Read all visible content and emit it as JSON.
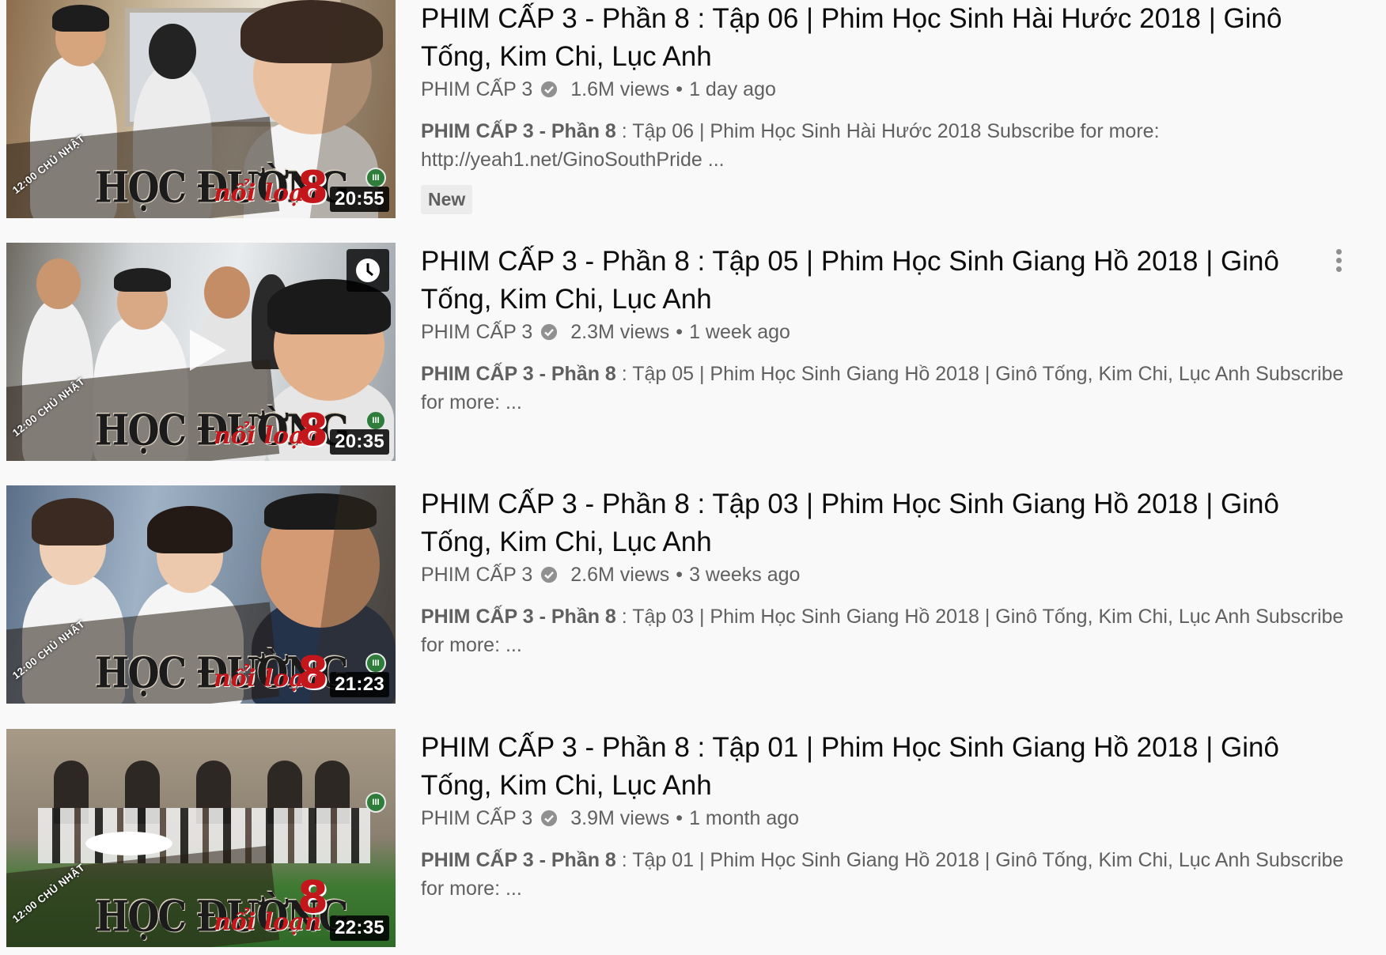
{
  "videos": [
    {
      "title": "PHIM CẤP 3 - Phần 8 : Tập 06 | Phim Học Sinh Hài Hước 2018 | Ginô Tống, Kim Chi, Lục Anh",
      "channel": "PHIM CẤP 3",
      "views": "1.6M views",
      "age": "1 day ago",
      "desc_bold": "PHIM CẤP 3 - Phần 8",
      "desc_rest": " : Tập 06 | Phim Học Sinh Hài Hước 2018 Subscribe for more: http://yeah1.net/GinoSouthPride ...",
      "badge": "New",
      "duration": "20:55",
      "thumb_logo": "HỌC ĐƯỜNG",
      "thumb_script": "nổi loạn",
      "thumb_num": "8",
      "thumb_sunday": "12:00 CHỦ NHẬT"
    },
    {
      "title": "PHIM CẤP 3 - Phần 8 : Tập 05 | Phim Học Sinh Giang Hồ 2018 | Ginô Tống, Kim Chi, Lục Anh",
      "channel": "PHIM CẤP 3",
      "views": "2.3M views",
      "age": "1 week ago",
      "desc_bold": "PHIM CẤP 3 - Phần 8",
      "desc_rest": " : Tập 05 | Phim Học Sinh Giang Hồ 2018 | Ginô Tống, Kim Chi, Lục Anh Subscribe for more: ...",
      "duration": "20:35",
      "thumb_logo": "HỌC ĐƯỜNG",
      "thumb_script": "nổi loạn",
      "thumb_num": "8",
      "thumb_sunday": "12:00 CHỦ NHẬT"
    },
    {
      "title": "PHIM CẤP 3 - Phần 8 : Tập 03 | Phim Học Sinh Giang Hồ 2018 | Ginô Tống, Kim Chi, Lục Anh",
      "channel": "PHIM CẤP 3",
      "views": "2.6M views",
      "age": "3 weeks ago",
      "desc_bold": "PHIM CẤP 3 - Phần 8",
      "desc_rest": " : Tập 03 | Phim Học Sinh Giang Hồ 2018 | Ginô Tống, Kim Chi, Lục Anh Subscribe for more: ...",
      "duration": "21:23",
      "thumb_logo": "HỌC ĐƯỜNG",
      "thumb_script": "nổi loạn",
      "thumb_num": "8",
      "thumb_sunday": "12:00 CHỦ NHẬT"
    },
    {
      "title": "PHIM CẤP 3 - Phần 8 : Tập 01 | Phim Học Sinh Giang Hồ 2018 | Ginô Tống, Kim Chi, Lục Anh",
      "channel": "PHIM CẤP 3",
      "views": "3.9M views",
      "age": "1 month ago",
      "desc_bold": "PHIM CẤP 3 - Phần 8",
      "desc_rest": " : Tập 01 | Phim Học Sinh Giang Hồ 2018 | Ginô Tống, Kim Chi, Lục Anh Subscribe for more: ...",
      "duration": "22:35",
      "thumb_logo": "HỌC ĐƯỜNG",
      "thumb_script": "nổi loạn",
      "thumb_num": "8",
      "thumb_sunday": "12:00 CHỦ NHẬT"
    }
  ],
  "colors": {
    "title": "#0d0d0d",
    "meta": "#606060",
    "background": "#f9f9f9",
    "logo_red": "#c4171c"
  },
  "icons": {
    "verified": "verified-check-icon",
    "watch_later": "clock-icon",
    "menu": "more-vert-icon",
    "play": "play-icon"
  }
}
